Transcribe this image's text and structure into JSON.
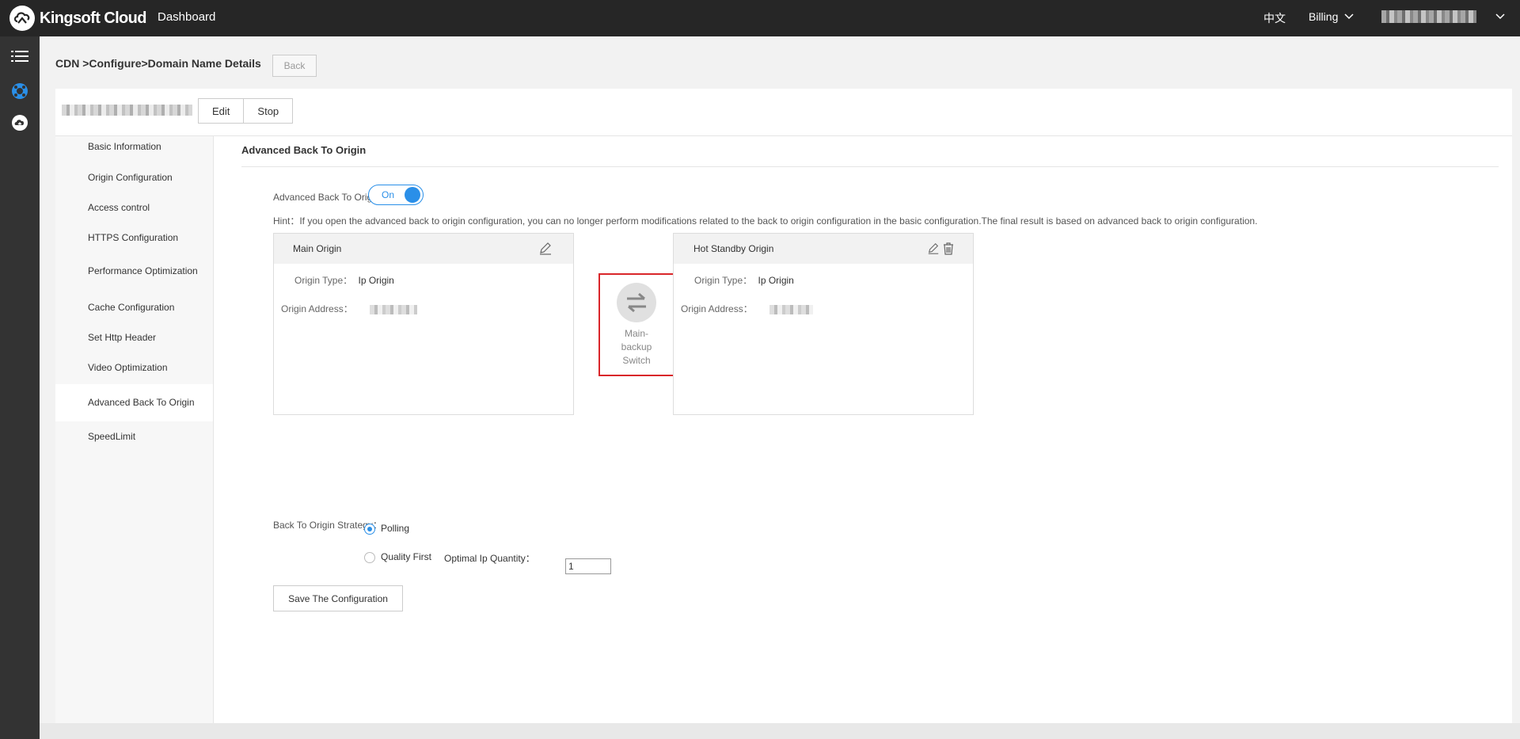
{
  "topbar": {
    "brand": "Kingsoft Cloud",
    "dashboard": "Dashboard",
    "language": "中文",
    "billing": "Billing"
  },
  "header": {
    "breadcrumb": "CDN >Configure>Domain Name Details",
    "back": "Back",
    "edit": "Edit",
    "stop": "Stop"
  },
  "sidebar": {
    "items": [
      {
        "label": "Basic Information"
      },
      {
        "label": "Origin Configuration"
      },
      {
        "label": "Access control"
      },
      {
        "label": "HTTPS Configuration"
      },
      {
        "label": "Performance Optimization"
      },
      {
        "label": "Cache Configuration"
      },
      {
        "label": "Set Http Header"
      },
      {
        "label": "Video Optimization"
      },
      {
        "label": "Advanced Back To Origin"
      },
      {
        "label": "SpeedLimit"
      }
    ]
  },
  "main": {
    "section_title": "Advanced Back To Origin",
    "toggle_label": "Advanced Back To Origin：",
    "toggle_value": "On",
    "hint": "Hint：If you open the advanced back to origin configuration, you can no longer perform modifications related to the back to origin configuration in the basic configuration.The final result is based on advanced back to origin configuration.",
    "main_origin": {
      "title": "Main Origin",
      "type_label": "Origin Type：",
      "type_value": "Ip Origin",
      "address_label": "Origin Address："
    },
    "standby_origin": {
      "title": "Hot Standby Origin",
      "type_label": "Origin Type：",
      "type_value": "Ip Origin",
      "address_label": "Origin Address："
    },
    "switch_label": "Main-backup Switch",
    "strategy_label": "Back To Origin Strategy：",
    "strategy_polling": "Polling",
    "strategy_quality": "Quality First",
    "optimal_qty_label": "Optimal Ip Quantity：",
    "optimal_qty_value": "1",
    "save": "Save The Configuration"
  }
}
